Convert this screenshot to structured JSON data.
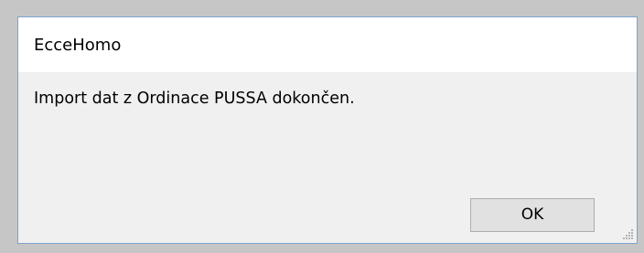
{
  "window": {
    "title": "EcceHomo"
  },
  "message": {
    "text": "Import dat z Ordinace PUSSA dokončen."
  },
  "buttons": {
    "ok_label": "OK"
  },
  "colors": {
    "border": "#7da2ce",
    "titlebar_bg": "#ffffff",
    "body_bg": "#f0f0f0",
    "button_bg": "#e1e1e1",
    "button_border": "#adadad"
  },
  "icons": {
    "resize_grip": "size-grip-icon"
  }
}
